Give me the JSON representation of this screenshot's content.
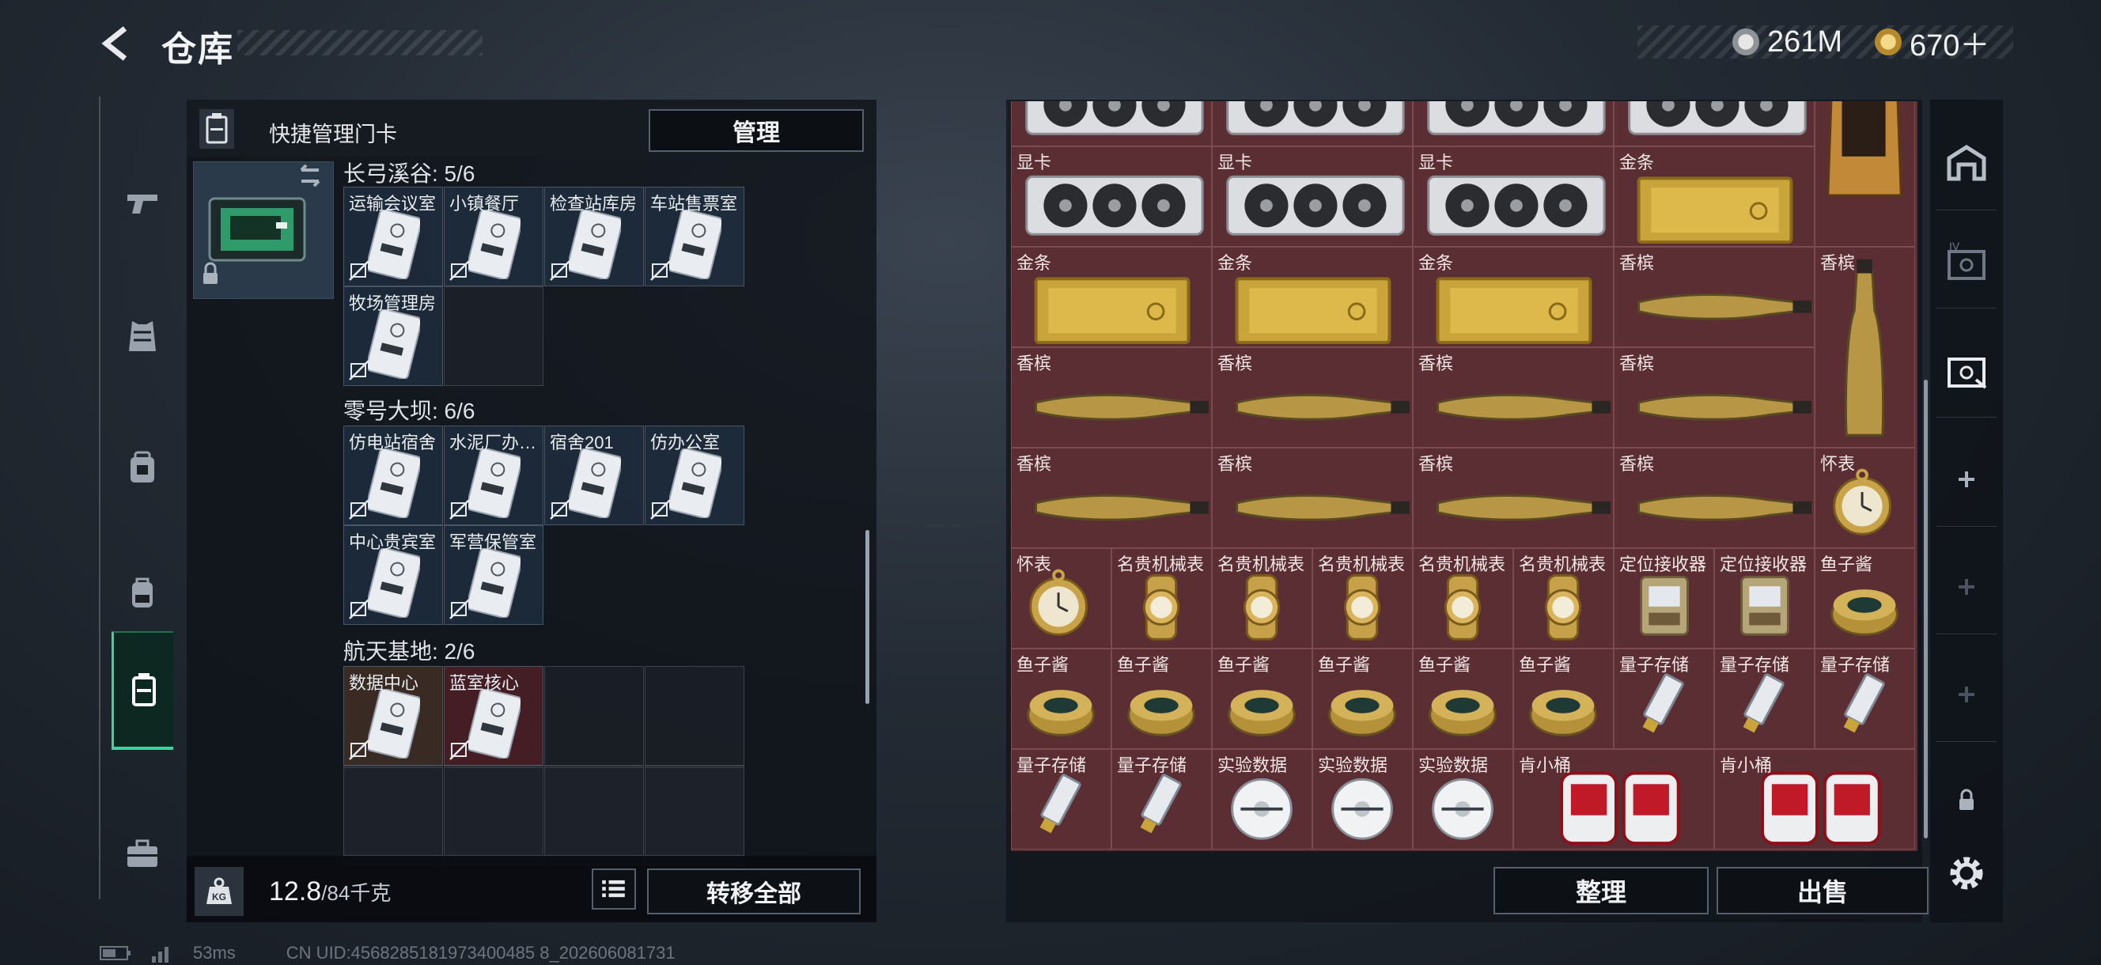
{
  "header": {
    "title": "仓库",
    "currencies": [
      {
        "icon": "silver-coin-icon",
        "value": "261M"
      },
      {
        "icon": "gold-coin-icon",
        "value": "670＋"
      }
    ]
  },
  "card_panel": {
    "header_label": "快捷管理门卡",
    "manage_label": "管理",
    "sections": [
      {
        "title": "长弓溪谷: 5/6",
        "slots": [
          "运输会议室",
          "小镇餐厅",
          "检查站库房",
          "车站售票室",
          "牧场管理房"
        ]
      },
      {
        "title": "零号大坝: 6/6",
        "slots": [
          "仿电站宿舍",
          "水泥厂办…",
          "宿舍201",
          "仿办公室",
          "中心贵宾室",
          "军营保管室"
        ]
      },
      {
        "title": "航天基地: 2/6",
        "slots": [
          "数据中心",
          "蓝室核心"
        ]
      }
    ],
    "weight": {
      "current": "12.8",
      "max": "/84千克"
    },
    "weight_icon_label": "KG",
    "transfer_label": "转移全部"
  },
  "stash": {
    "items": [
      {
        "label": "显卡",
        "icon": "gpu-icon"
      },
      {
        "label": "显卡",
        "icon": "gpu-icon"
      },
      {
        "label": "显卡",
        "icon": "gpu-icon"
      },
      {
        "label": "金条",
        "icon": "gold-bar-icon"
      },
      {
        "label": "金条",
        "icon": "gold-bar-icon"
      },
      {
        "label": "金条",
        "icon": "gold-bar-icon"
      },
      {
        "label": "金条",
        "icon": "gold-bar-icon"
      },
      {
        "label": "香槟",
        "icon": "champagne-icon"
      },
      {
        "label": "香槟",
        "icon": "champagne-icon"
      },
      {
        "label": "香槟",
        "icon": "champagne-icon"
      },
      {
        "label": "香槟",
        "icon": "champagne-icon"
      },
      {
        "label": "香槟",
        "icon": "champagne-icon"
      },
      {
        "label": "香槟",
        "icon": "champagne-icon"
      },
      {
        "label": "香槟",
        "icon": "champagne-icon"
      },
      {
        "label": "香槟",
        "icon": "champagne-icon"
      },
      {
        "label": "香槟",
        "icon": "champagne-icon"
      },
      {
        "label": "香槟",
        "icon": "champagne-icon"
      },
      {
        "label": "怀表",
        "icon": "pocket-watch-icon"
      },
      {
        "label": "怀表",
        "icon": "pocket-watch-icon"
      },
      {
        "label": "名贵机械表",
        "icon": "wristwatch-icon"
      },
      {
        "label": "名贵机械表",
        "icon": "wristwatch-icon"
      },
      {
        "label": "名贵机械表",
        "icon": "wristwatch-icon"
      },
      {
        "label": "名贵机械表",
        "icon": "wristwatch-icon"
      },
      {
        "label": "名贵机械表",
        "icon": "wristwatch-icon"
      },
      {
        "label": "定位接收器",
        "icon": "receiver-icon"
      },
      {
        "label": "定位接收器",
        "icon": "receiver-icon"
      },
      {
        "label": "鱼子酱",
        "icon": "caviar-icon"
      },
      {
        "label": "鱼子酱",
        "icon": "caviar-icon"
      },
      {
        "label": "鱼子酱",
        "icon": "caviar-icon"
      },
      {
        "label": "鱼子酱",
        "icon": "caviar-icon"
      },
      {
        "label": "鱼子酱",
        "icon": "caviar-icon"
      },
      {
        "label": "鱼子酱",
        "icon": "caviar-icon"
      },
      {
        "label": "鱼子酱",
        "icon": "caviar-icon"
      },
      {
        "label": "量子存储",
        "icon": "quantum-storage-icon"
      },
      {
        "label": "量子存储",
        "icon": "quantum-storage-icon"
      },
      {
        "label": "量子存储",
        "icon": "quantum-storage-icon"
      },
      {
        "label": "量子存储",
        "icon": "quantum-storage-icon"
      },
      {
        "label": "量子存储",
        "icon": "quantum-storage-icon"
      },
      {
        "label": "实验数据",
        "icon": "data-disc-icon"
      },
      {
        "label": "实验数据",
        "icon": "data-disc-icon"
      },
      {
        "label": "实验数据",
        "icon": "data-disc-icon"
      },
      {
        "label": "肯小桶",
        "icon": "bucket-icon"
      },
      {
        "label": "肯小桶",
        "icon": "bucket-icon"
      }
    ],
    "sort_label": "整理",
    "sell_label": "出售"
  },
  "status": {
    "ping": "53ms",
    "uid": "CN UID:4568285181973400485 8_202606081731"
  },
  "colors": {
    "accent": "#3cd39c",
    "stash_bg": "#5a2e33",
    "gold": "#c9a43a"
  }
}
